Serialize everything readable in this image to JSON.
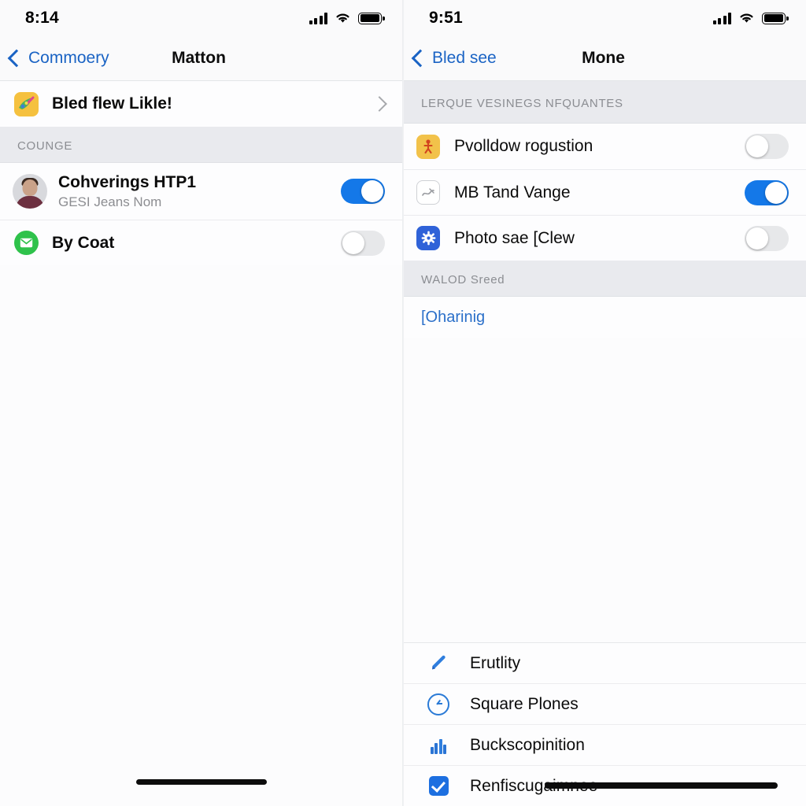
{
  "left_panel": {
    "status": {
      "time": "8:14",
      "signal_icon": "cellular-bars-icon",
      "wifi_icon": "wifi-icon",
      "battery_icon": "battery-full-icon"
    },
    "nav": {
      "back_label": "Commoery",
      "title": "Matton",
      "back_icon": "chevron-left-icon"
    },
    "featured_row": {
      "icon": "app-icon-colorful",
      "title": "Bled flew Likle!",
      "accessory_icon": "chevron-right-icon"
    },
    "section_label": "COUNGE",
    "rows": [
      {
        "icon": "avatar-photo",
        "title": "Cohverings HTP1",
        "subtitle": "GESI Jeans Nom",
        "toggle": "on"
      },
      {
        "icon": "messages-envelope-icon",
        "title": "By Coat",
        "subtitle": "",
        "toggle": "off"
      }
    ]
  },
  "right_panel": {
    "status": {
      "time": "9:51",
      "signal_icon": "cellular-bars-icon",
      "wifi_icon": "wifi-icon",
      "battery_icon": "battery-full-icon"
    },
    "nav": {
      "back_label": "Bled see",
      "title": "Mone",
      "back_icon": "chevron-left-icon"
    },
    "section_one_label": "LERQUE VESINEGS NFQUANTES",
    "toggle_rows": [
      {
        "icon": "app-icon-yellow",
        "title": "Pvolldow rogustion",
        "toggle": "off"
      },
      {
        "icon": "app-icon-outline-scribble",
        "title": "MB Tand Vange",
        "toggle": "on"
      },
      {
        "icon": "gear-icon-blue",
        "title": "Photo sae [Clew",
        "toggle": "off"
      }
    ],
    "section_two_label": "WALOD Sreed",
    "link_row": {
      "label": "[Oharinig"
    },
    "bottom_items": [
      {
        "icon": "pencil-icon",
        "label": "Erutlity"
      },
      {
        "icon": "clock-icon",
        "label": "Square Plones"
      },
      {
        "icon": "chart-bars-icon",
        "label": "Buckscopinition"
      },
      {
        "icon": "checkbox-checked-icon",
        "label": "Renfiscugaimnee"
      }
    ]
  },
  "colors": {
    "accent_blue": "#1478e8",
    "link_blue": "#1a63c4",
    "toggle_off": "#e7e8ea",
    "section_bg": "#e9eaee",
    "row_bg": "#fdfdfe"
  }
}
